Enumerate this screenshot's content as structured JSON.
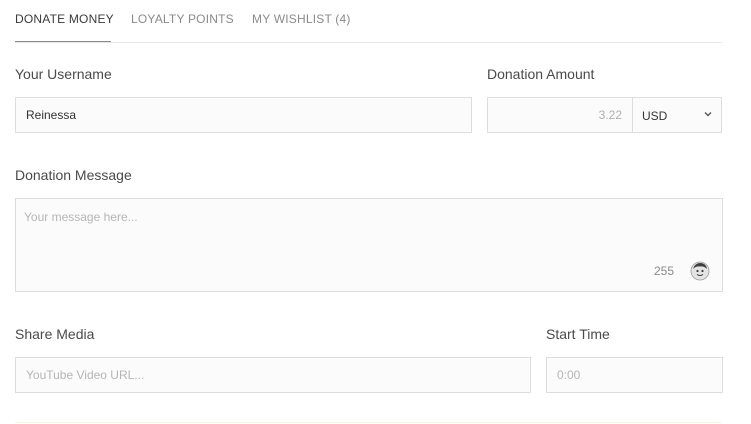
{
  "tabs": [
    {
      "label": "DONATE MONEY",
      "active": true
    },
    {
      "label": "LOYALTY POINTS",
      "active": false
    },
    {
      "label": "MY WISHLIST (4)",
      "active": false
    }
  ],
  "form": {
    "username": {
      "label": "Your Username",
      "value": "Reinessa"
    },
    "amount": {
      "label": "Donation Amount",
      "placeholder": "3.22",
      "currency": "USD"
    },
    "message": {
      "label": "Donation Message",
      "placeholder": "Your message here...",
      "char_count": "255"
    },
    "media": {
      "label": "Share Media",
      "placeholder": "YouTube Video URL..."
    },
    "start_time": {
      "label": "Start Time",
      "placeholder": "0:00"
    }
  },
  "icons": {
    "currency_dropdown": "chevron-down-icon",
    "emote": "emote-face-icon"
  }
}
